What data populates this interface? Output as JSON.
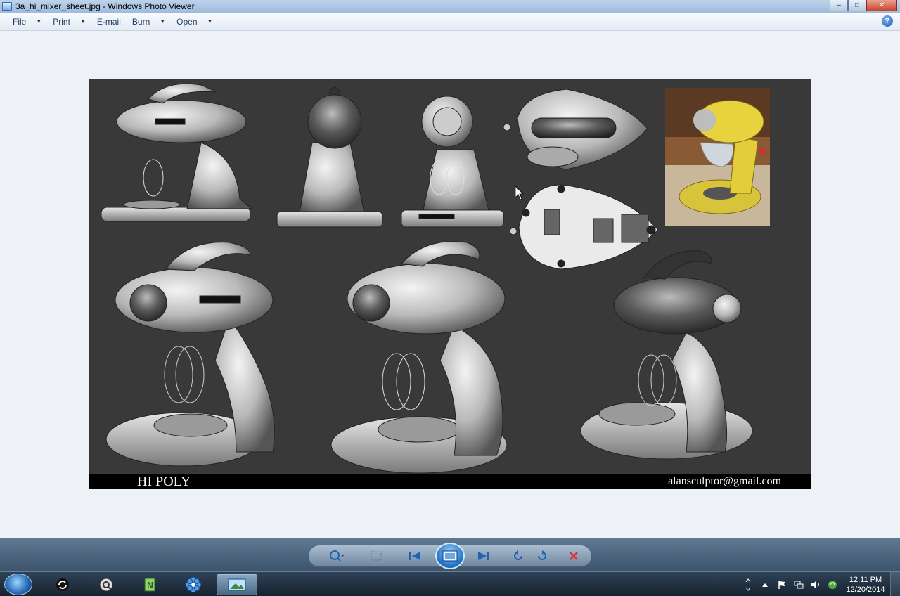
{
  "window": {
    "title": "3a_hi_mixer_sheet.jpg - Windows Photo Viewer",
    "minimize": "‒",
    "maximize": "□",
    "close": "✕"
  },
  "menu": {
    "items": [
      {
        "label": "File",
        "has_dropdown": true
      },
      {
        "label": "Print",
        "has_dropdown": true
      },
      {
        "label": "E-mail",
        "has_dropdown": false
      },
      {
        "label": "Burn",
        "has_dropdown": true
      },
      {
        "label": "Open",
        "has_dropdown": true
      }
    ],
    "help_glyph": "?"
  },
  "image": {
    "caption_left": "HI POLY",
    "caption_right": "alansculptor@gmail.com",
    "background_color": "#393939"
  },
  "controls": {
    "icons": [
      "zoom-icon",
      "actual-size-icon",
      "previous-icon",
      "slideshow-icon",
      "next-icon",
      "rotate-counterclockwise-icon",
      "rotate-clockwise-icon",
      "delete-icon"
    ]
  },
  "taskbar": {
    "pinned_icons": [
      "start-orb",
      "sync-app-icon",
      "quicktime-icon",
      "notepad-plus-icon",
      "flower-app-icon",
      "photo-viewer-icon"
    ],
    "time": "12:11 PM",
    "date": "12/20/2014"
  },
  "colors": {
    "titlebar": "#b3cde8",
    "control_bar": "#4d6680",
    "close_button": "#c9452f"
  }
}
